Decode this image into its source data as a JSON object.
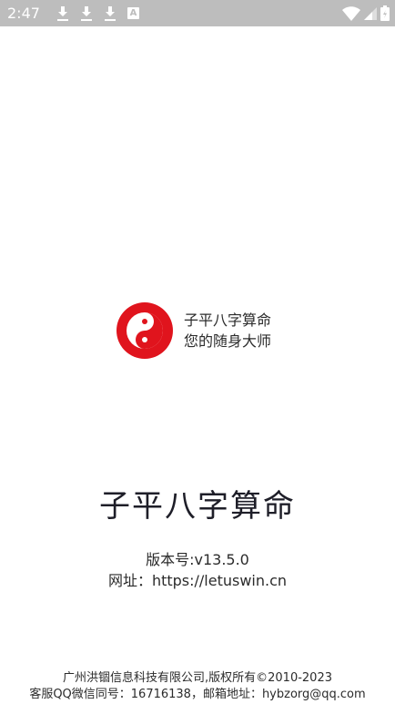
{
  "status_bar": {
    "time": "2:47",
    "notification_icons": [
      "download-icon",
      "download-icon",
      "download-icon",
      "a-icon"
    ],
    "system_icons": [
      "wifi-icon",
      "signal-icon",
      "battery-icon"
    ],
    "background": "#bdbdbd"
  },
  "splash": {
    "logo_icon": "yin-yang-icon",
    "logo_color": "#e0141d",
    "slogan_line1": "子平八字算命",
    "slogan_line2": "您的随身大师",
    "app_name": "子平八字算命",
    "version": "版本号:v13.5.0",
    "website": "网址：https://letuswin.cn",
    "copyright": "广州洪锢信息科技有限公司,版权所有©2010-2023",
    "contact": "客服QQ微信同号：16716138，邮箱地址：hybzorg@qq.com"
  }
}
